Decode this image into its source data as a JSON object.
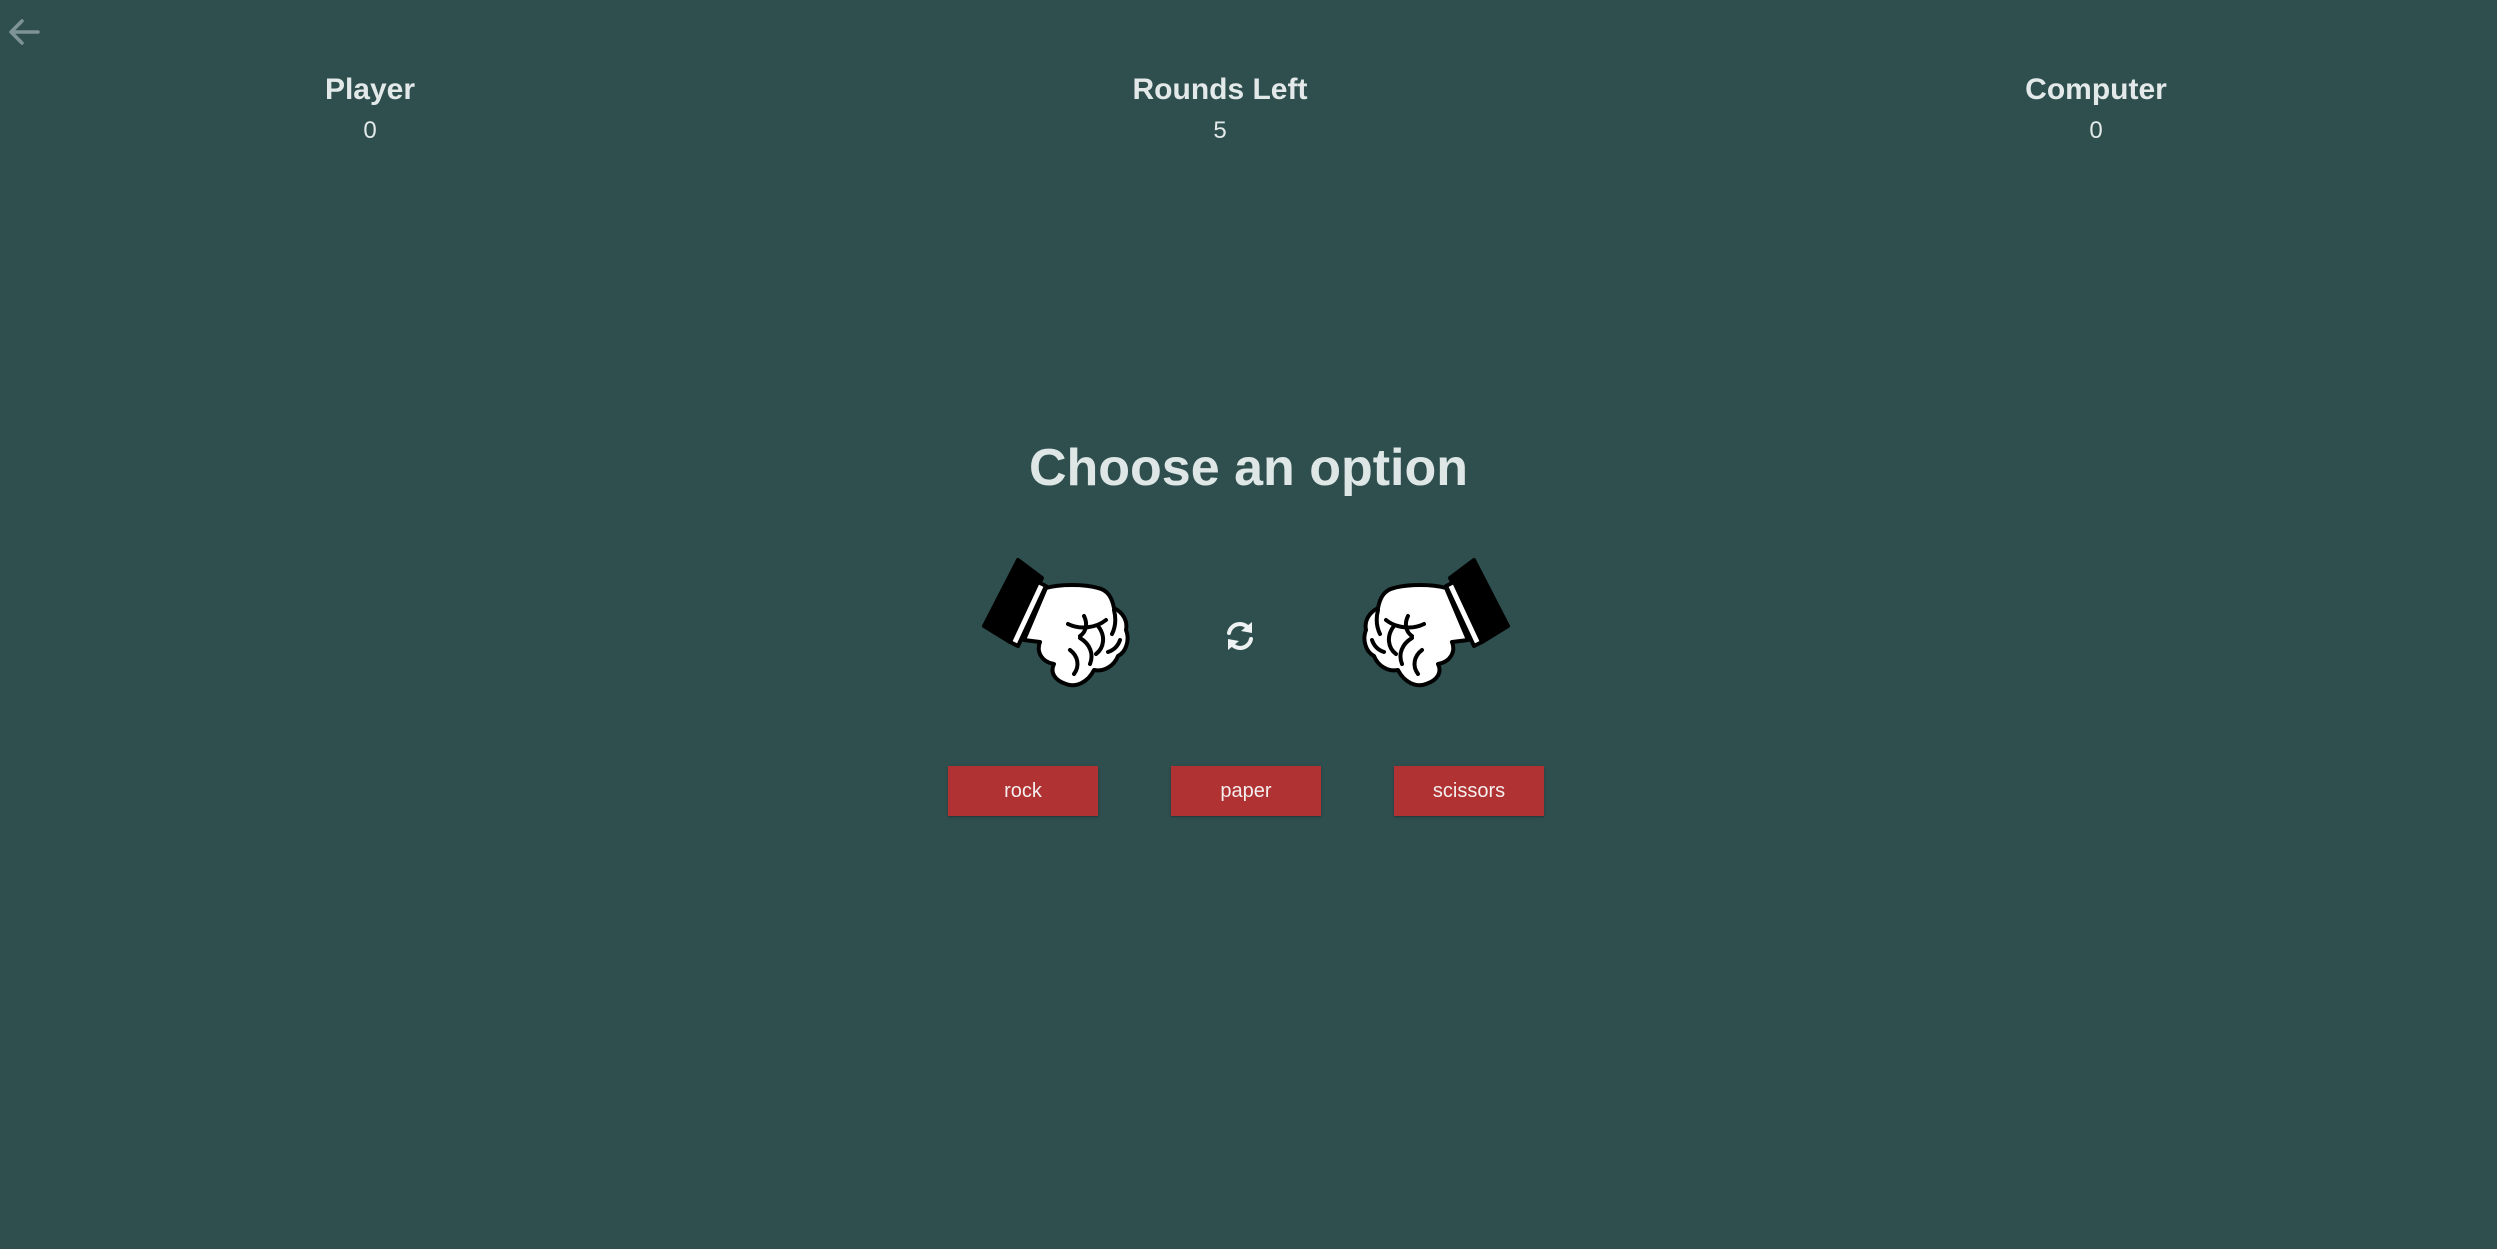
{
  "nav": {
    "back_icon": "arrow-left-icon"
  },
  "scoreboard": {
    "player_label": "Player",
    "player_score": "0",
    "rounds_label": "Rounds Left",
    "rounds_value": "5",
    "computer_label": "Computer",
    "computer_score": "0"
  },
  "prompt": {
    "text": "Choose an option"
  },
  "arena": {
    "player_hand_icon": "fist-hand-icon",
    "computer_hand_icon": "fist-hand-icon",
    "restart_icon": "refresh-icon"
  },
  "choices": {
    "rock": "rock",
    "paper": "paper",
    "scissors": "scissors"
  },
  "colors": {
    "background": "#2f4f4f",
    "button": "#b03232",
    "text": "#dfe6e6"
  }
}
